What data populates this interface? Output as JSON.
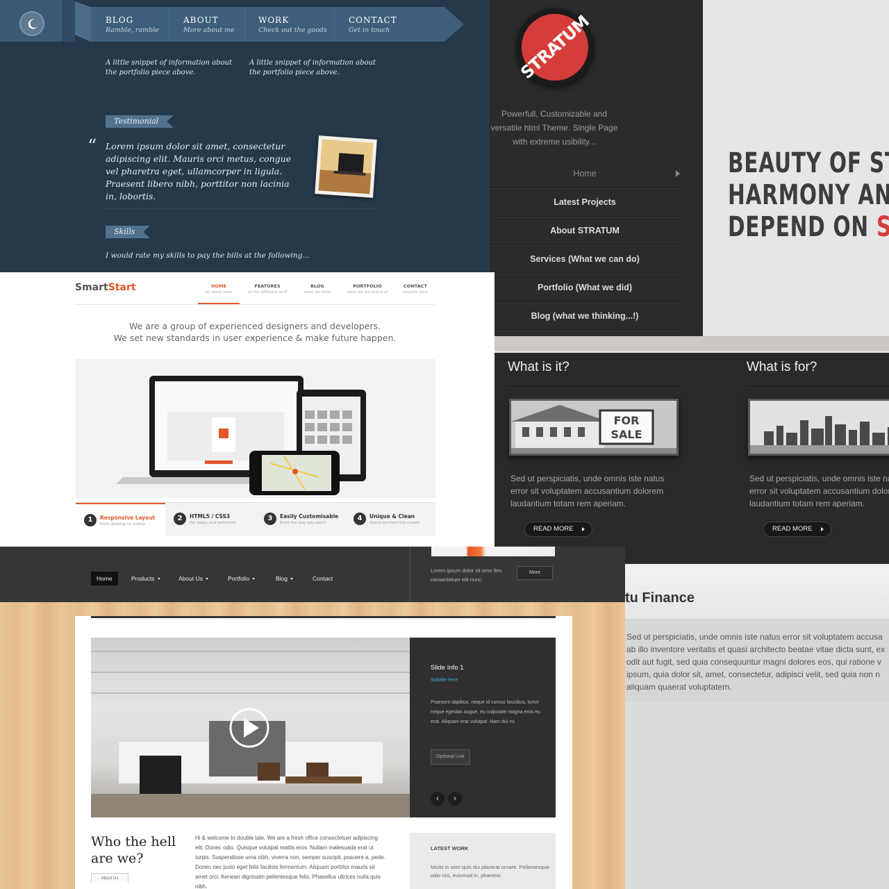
{
  "portfolio_theme": {
    "nav": [
      {
        "title": "BLOG",
        "subtitle": "Ramble, ramble"
      },
      {
        "title": "ABOUT",
        "subtitle": "More about me"
      },
      {
        "title": "WORK",
        "subtitle": "Check out the goods"
      },
      {
        "title": "CONTACT",
        "subtitle": "Get in touch"
      }
    ],
    "snippets": [
      "A little snippet of information about the portfolio piece above.",
      "A little snippet of information about the portfolio piece above."
    ],
    "testimonial_tag": "Testimonial",
    "quote_mark": "“",
    "testimonial_quote": "Lorem ipsum dolor sit amet, consectetur adipiscing elit. Mauris orci metus, congue vel pharetra eget, ullamcorper in ligula. Praesent libero nibh, porttitor non lacinia in, lobortis.",
    "skills_tag": "Skills",
    "skills_text": "I would rate my skills to pay the bills at the following...",
    "icons": {
      "moon": "moon-icon",
      "photo": "laptop-photo"
    }
  },
  "stratum": {
    "logo_text": "STRATUM",
    "tagline": "Powerfull, Customizable and versatile html Theme. Single Page with extreme usibility...",
    "menu": [
      "Home",
      "Latest Projects",
      "About STRATUM",
      "Services (What we can do)",
      "Portfolio (What we did)",
      "Blog (what we thinking...!)"
    ]
  },
  "beauty": {
    "line1": "BEAUTY OF STY",
    "line2": "HARMONY AND",
    "line3_prefix": "DEPEND ON ",
    "line3_accent": "SIM",
    "accent_color": "#d43d3a"
  },
  "smartstart": {
    "brand_prefix": "Smart",
    "brand_accent": "Start",
    "accent_color": "#e2572b",
    "nav": [
      {
        "title": "HOME",
        "subtitle": "all starts here"
      },
      {
        "title": "FEATURES",
        "subtitle": "all the different stuff"
      },
      {
        "title": "BLOG",
        "subtitle": "what we think"
      },
      {
        "title": "PORTFOLIO",
        "subtitle": "work we are proud of"
      },
      {
        "title": "CONTACT",
        "subtitle": "enquire here"
      }
    ],
    "intro_line1": "We are a group of experienced designers and developers.",
    "intro_line2": "We set new standards in user experience & make future happen.",
    "features": [
      {
        "num": "1",
        "title": "Responsive Layout",
        "subtitle": "From desktop to mobile"
      },
      {
        "num": "2",
        "title": "HTML5 / CSS3",
        "subtitle": "For today and tomorrow"
      },
      {
        "num": "3",
        "title": "Easily Customisable",
        "subtitle": "Build the way you want!"
      },
      {
        "num": "4",
        "title": "Unique & Clean",
        "subtitle": "Stand out from the crowd!"
      }
    ]
  },
  "what_section": {
    "columns": [
      {
        "title": "What is it?",
        "text": "Sed ut perspiciatis, unde omnis iste natus error sit voluptatem accusantium dolorem laudantium totam rem aperiam.",
        "button": "READ MORE",
        "image": "for-sale-house-photo",
        "sign_line1": "FOR",
        "sign_line2": "SALE"
      },
      {
        "title": "What is for?",
        "text": "Sed ut perspiciatis, unde omnis iste natus error sit voluptatem accusantium dolorem laudantium totam rem aperiam.",
        "button": "READ MORE",
        "image": "city-skyline-photo"
      }
    ]
  },
  "finance": {
    "title": "tu Finance",
    "lines": [
      "Sed ut perspiciatis, unde omnis iste natus error sit voluptatem accusa",
      "ab illo inventore veritatis et quasi architecto beatae vitae dicta sunt, ex",
      "odit aut fugit, sed quia consequuntur magni dolores eos, qui ratione v",
      "ipsum, quia dolor sit, amet, consectetur, adipisci velit, sed quia non n",
      "aliquam quaerat voluptatem."
    ]
  },
  "wood_theme": {
    "nav": [
      "Home",
      "Products",
      "About Us",
      "Portfolio",
      "Blog",
      "Contact"
    ],
    "promo_text": "Lorem ipsum dolor sit ame tleo consectetuer elit nunc.",
    "more_button": "More",
    "slide": {
      "title": "Slide Info 1",
      "subtitle": "Subtitle here",
      "text": "Praesent dapibus, neque id cursus faucibus, tortor neque egestas augue, eu vulputate magna eros eu erat. Aliquam erat volutpat. Nam dui mi.",
      "link": "Optional Link",
      "prev": "‹",
      "next": "›"
    },
    "who_title_line1": "Who the hell",
    "who_title_line2": "are we?",
    "who_button": "About Us",
    "who_text": "Hi & welcome to double tale. We are a fresh office consectetuer adipiscing elit. Donec odio. Quisque volutpat mattis eros. Nullam malesuada erat ut turpis. Suspendisse urna nibh, viverra non, semper suscipit, posuere a, pede. Donec nec justo eget felis facilisis fermentum. Aliquam porttitor mauris sit amet orci. Aenean dignissim pellentesque felis. Phasellus ultrices nulla quis nibh.",
    "latest_title": "LATEST WORK",
    "latest_text": "Morbi in sem quis dui placerat ornare. Pellentesque odio nisi, euismod in, pharetra."
  }
}
